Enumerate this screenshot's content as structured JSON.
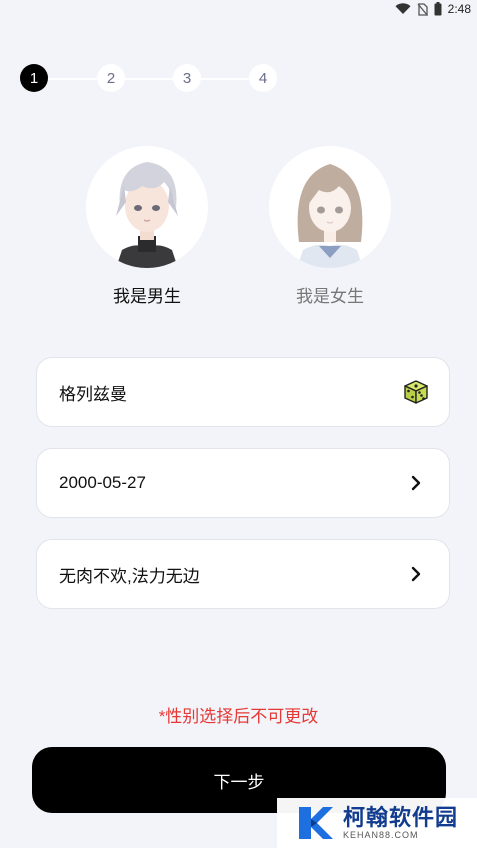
{
  "status_bar": {
    "time": "2:48",
    "icons": [
      "wifi-icon",
      "no-sim-icon",
      "battery-icon"
    ]
  },
  "stepper": {
    "steps": [
      "1",
      "2",
      "3",
      "4"
    ],
    "active_index": 0
  },
  "gender": {
    "male_label": "我是男生",
    "female_label": "我是女生",
    "selected": "male"
  },
  "form": {
    "nickname": "格列兹曼",
    "nickname_icon": "dice-icon",
    "birthday": "2000-05-27",
    "signature": "无肉不欢,法力无边"
  },
  "notice": "*性别选择后不可更改",
  "next_button": "下一步",
  "watermark": {
    "main": "柯翰软件园",
    "sub": "KEHAN88.COM"
  },
  "colors": {
    "accent": "#000000",
    "background": "#f3f4f9",
    "notice": "#e53935",
    "watermark": "#123c8f"
  }
}
